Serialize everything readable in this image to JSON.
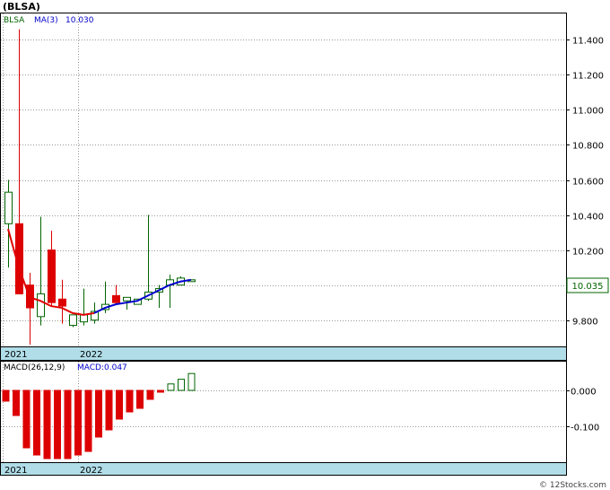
{
  "header": {
    "title": "(BLSA)"
  },
  "watermark": "© 12Stocks.com",
  "colors": {
    "up": "#006400",
    "down": "#dd0000",
    "ma_red": "#e00000",
    "ma_blue": "#0000cc",
    "grid": "#999999",
    "date_strip": "#b0dde8",
    "price_box_fg": "#006400"
  },
  "chart_data": [
    {
      "type": "candlestick",
      "name": "price",
      "legend": {
        "symbol": "BLSA",
        "ma_label": "MA(3)",
        "ma_value": "10.030"
      },
      "last_price_label": "10.035",
      "ylim": [
        9.65,
        11.55
      ],
      "y_ticks": [
        "11.400",
        "11.200",
        "11.000",
        "10.800",
        "10.600",
        "10.400",
        "10.200",
        "10.000",
        "9.800"
      ],
      "x_labels": [
        "2021",
        "2022"
      ],
      "candles": [
        {
          "o": 10.35,
          "h": 10.6,
          "l": 10.1,
          "c": 10.53
        },
        {
          "o": 10.35,
          "h": 11.46,
          "l": 10.05,
          "c": 9.95
        },
        {
          "o": 10.0,
          "h": 10.07,
          "l": 9.66,
          "c": 9.87
        },
        {
          "o": 9.82,
          "h": 10.39,
          "l": 9.77,
          "c": 9.95
        },
        {
          "o": 10.2,
          "h": 10.31,
          "l": 9.88,
          "c": 9.9
        },
        {
          "o": 9.92,
          "h": 10.03,
          "l": 9.78,
          "c": 9.88
        },
        {
          "o": 9.77,
          "h": 9.83,
          "l": 9.76,
          "c": 9.83
        },
        {
          "o": 9.79,
          "h": 9.98,
          "l": 9.77,
          "c": 9.83
        },
        {
          "o": 9.8,
          "h": 9.9,
          "l": 9.78,
          "c": 9.85
        },
        {
          "o": 9.86,
          "h": 10.02,
          "l": 9.84,
          "c": 9.89
        },
        {
          "o": 9.94,
          "h": 10.0,
          "l": 9.89,
          "c": 9.9
        },
        {
          "o": 9.91,
          "h": 9.93,
          "l": 9.86,
          "c": 9.93
        },
        {
          "o": 9.89,
          "h": 9.92,
          "l": 9.89,
          "c": 9.92
        },
        {
          "o": 9.92,
          "h": 10.4,
          "l": 9.91,
          "c": 9.96
        },
        {
          "o": 9.96,
          "h": 10.0,
          "l": 9.87,
          "c": 9.98
        },
        {
          "o": 10.0,
          "h": 10.06,
          "l": 9.87,
          "c": 10.03
        },
        {
          "o": 10.0,
          "h": 10.05,
          "l": 10.0,
          "c": 10.04
        },
        {
          "o": 10.03,
          "h": 10.03,
          "l": 10.02,
          "c": 10.03
        }
      ],
      "ma3": [
        10.32,
        10.1,
        9.93,
        9.91,
        9.88,
        9.87,
        9.84,
        9.83,
        9.84,
        9.87,
        9.89,
        9.9,
        9.91,
        9.94,
        9.97,
        10.0,
        10.02,
        10.03
      ],
      "ma3_red_until_index": 8,
      "x_label_index": {
        "2021": 0,
        "2022": 7
      }
    },
    {
      "type": "bar",
      "name": "macd",
      "legend": {
        "label": "MACD(26,12,9)",
        "value_label": "MACD:0.047"
      },
      "ylim": [
        -0.2,
        0.08
      ],
      "y_ticks": [
        "0.000",
        "-0.100"
      ],
      "x_labels": [
        "2021",
        "2022"
      ],
      "values": [
        -0.03,
        -0.07,
        -0.16,
        -0.18,
        -0.19,
        -0.19,
        -0.19,
        -0.18,
        -0.17,
        -0.13,
        -0.11,
        -0.08,
        -0.06,
        -0.05,
        -0.025,
        -0.005,
        0.018,
        0.031,
        0.047
      ]
    }
  ]
}
